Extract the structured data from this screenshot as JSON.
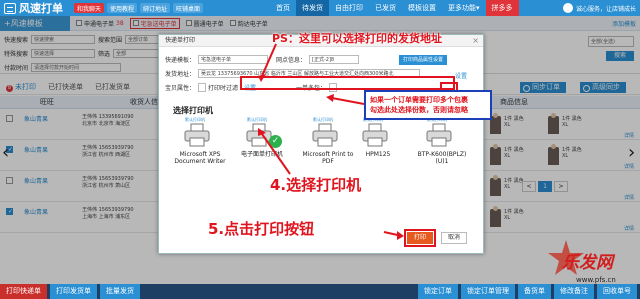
{
  "app": {
    "title": "风速打单",
    "top_buttons": [
      "和我聊天",
      "使用教程",
      "绑订地址",
      "旺铺桌面"
    ],
    "nav": [
      "首页",
      "待发货",
      "自由打印",
      "已发货",
      "模板设置",
      "更多功能▾",
      "拼多多"
    ],
    "nav_active_index": 1,
    "nav_hot_index": 6,
    "user_text": "诚心服务，让店铺成长"
  },
  "template_bar": {
    "title": "+风速模板",
    "tabs": [
      {
        "label": "申通电子单",
        "count": "38",
        "selected": false
      },
      {
        "label": "宅急送电子单",
        "count": "",
        "selected": true
      },
      {
        "label": "圆通电子单",
        "count": "",
        "selected": false
      },
      {
        "label": "韵达电子单",
        "count": "",
        "selected": false
      }
    ],
    "right_link": "添加模板"
  },
  "filters": {
    "row1": {
      "label": "快速搜索",
      "value": "快速搜索",
      "label2": "搜索范围",
      "value2": "全部订单"
    },
    "row2": {
      "label": "特殊搜索",
      "value": "快速选择",
      "label2": "筛选",
      "value2": "全部"
    },
    "row3": {
      "label": "付款时间",
      "value": "请选择付款开始时间"
    },
    "search_placeholder": "全部(全选)",
    "search_button": "搜索"
  },
  "order_tabs": {
    "tabs": [
      "未打印",
      "已打快递单",
      "已打发货单"
    ],
    "count": "8",
    "active_index": 0,
    "right_buttons": [
      "同步订单",
      "高级同步"
    ]
  },
  "table": {
    "headers": [
      "旺旺",
      "收货人信息",
      "商品信息"
    ],
    "rows": [
      {
        "name": "象山青果",
        "buyer": "王伟伟 13395691090",
        "addr": "北京市 北京市 海淀区",
        "qty": "1件 黑色 XL",
        "checked": false
      },
      {
        "name": "象山青果",
        "buyer": "王伟伟 15653939790",
        "addr": "浙江省 杭州市 西湖区",
        "qty": "1件 黑色 XL",
        "checked": true
      },
      {
        "name": "象山青果",
        "buyer": "王伟伟 15653939790",
        "addr": "浙江省 杭州市 萧山区",
        "qty": "1件 黑色 XL",
        "checked": false
      },
      {
        "name": "象山青果",
        "buyer": "王伟伟 15653939790",
        "addr": "上海市 上海市 浦东区",
        "qty": "1件 黑色 XL",
        "checked": true
      }
    ],
    "detail_label": "详情"
  },
  "pagination": [
    "<",
    "1",
    ">"
  ],
  "pagination_active": 1,
  "bottom_buttons": {
    "left": [
      "打印快递单",
      "打印发货单",
      "批量发货"
    ],
    "right": [
      "锁定订单",
      "锁定订单管理",
      "备货单",
      "修改备注",
      "回收单号"
    ]
  },
  "dialog": {
    "title": "快递单打印",
    "close_icon": "×",
    "template_label": "快递模板：",
    "template_value": "宅急送电子单",
    "network_label": "网点信息：",
    "network_value": "[正式-2]8",
    "network_button": "打印商品属性设置",
    "sender_label": "发货地址：",
    "sender_value": "吴云龙 13375693670 山东省 临沂市 兰山区 解放路与工业大道交汇处向西300米路北",
    "sender_link": "设置",
    "prop_label": "宝贝属性：",
    "prop_option": "打印时过滤",
    "prop_link": "设置",
    "multi_label": "一单多包：",
    "section_title": "选择打印机",
    "default_tag": "默认打印机",
    "printers": [
      {
        "label": "Microsoft XPS Document Writer",
        "selected": false
      },
      {
        "label": "电子面单打印机",
        "selected": true
      },
      {
        "label": "Microsoft Print to PDF",
        "selected": false
      },
      {
        "label": "HPM125",
        "selected": false
      },
      {
        "label": "BTP-K600(BPLZ) (U)1",
        "selected": false
      }
    ],
    "print_button": "打印",
    "cancel_button": "取消"
  },
  "annotations": {
    "ps": "PS：这里可以选择打印的发货地址",
    "box_line1": "如果一个订单需要打印多个包裹",
    "box_line2": "勾选此处选择份数，否则请忽略",
    "step4": "4.选择打印机",
    "step5": "5.点击打印按钮"
  },
  "watermark": {
    "text": "乐发网",
    "url": "www.pfs.cn"
  },
  "colors": {
    "brand_blue": "#2a8fd3",
    "accent_red": "#e0141e",
    "print_orange": "#e75a1f",
    "success_green": "#2bb24c",
    "annotation_box_blue": "#1a3fb8"
  }
}
